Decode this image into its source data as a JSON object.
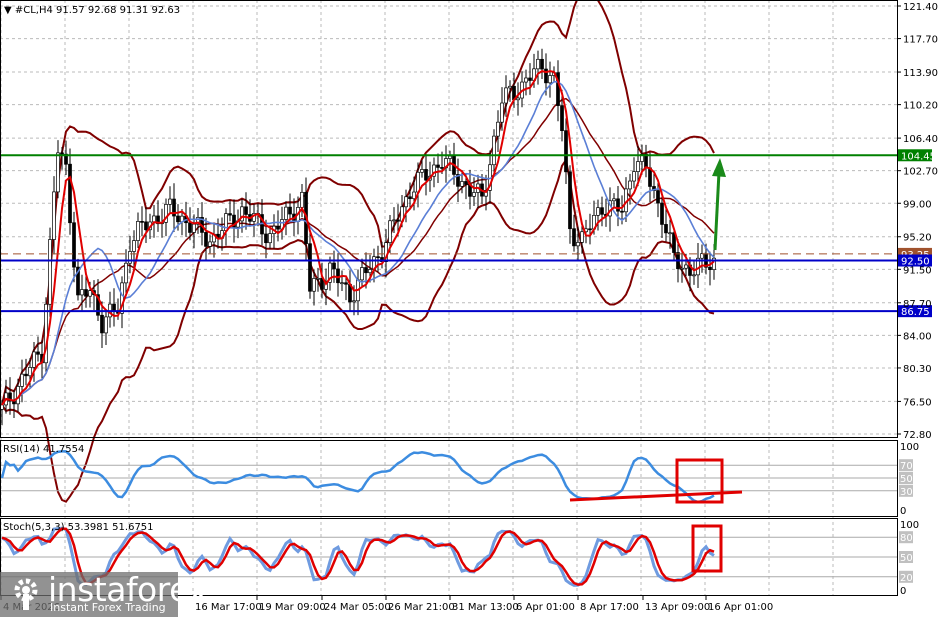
{
  "header": {
    "symbol_line": "#CL,H4  91.57 92.68 91.31 92.63"
  },
  "price_axis": {
    "labels": [
      "121.40",
      "117.70",
      "113.90",
      "110.20",
      "106.40",
      "102.70",
      "99.00",
      "95.20",
      "91.50",
      "87.70",
      "84.00",
      "80.30",
      "76.50",
      "72.80"
    ]
  },
  "levels": {
    "resistance": {
      "label": "104.45",
      "value": 104.45,
      "color": "#008000"
    },
    "current": {
      "label": "93.25",
      "value": 93.25,
      "color": "#a0522d"
    },
    "support1": {
      "label": "92.50",
      "value": 92.5,
      "color": "#0000c8"
    },
    "support2": {
      "label": "86.75",
      "value": 86.75,
      "color": "#0000c8"
    }
  },
  "rsi": {
    "title": "RSI(14) 41.7554",
    "labels": [
      "100",
      "70",
      "50",
      "30",
      "0"
    ]
  },
  "stoch": {
    "title": "Stoch(5,3,3) 53.3981 51.6751",
    "labels": [
      "100",
      "80",
      "50",
      "20",
      "0"
    ]
  },
  "time_axis": {
    "labels": [
      "4 Mar 2026",
      "16 Mar 17:00",
      "19 Mar 09:00",
      "24 Mar 05:00",
      "26 Mar 21:00",
      "31 Mar 13:00",
      "6 Apr 01:00",
      "8 Apr 17:00",
      "13 Apr 09:00",
      "16 Apr 01:00"
    ]
  },
  "watermark": {
    "brand": "instaforex",
    "tagline": "Instant Forex Trading"
  },
  "chart_data": {
    "type": "candlestick",
    "title": "#CL,H4",
    "ylim": [
      72.8,
      121.4
    ],
    "close_keypoints": [
      [
        0,
        75.5
      ],
      [
        5,
        79
      ],
      [
        10,
        82.3
      ],
      [
        13,
        100
      ],
      [
        14,
        105
      ],
      [
        16,
        102.8
      ],
      [
        19,
        88
      ],
      [
        22,
        89
      ],
      [
        25,
        85.7
      ],
      [
        29,
        86.9
      ],
      [
        32,
        94.8
      ],
      [
        37,
        97
      ],
      [
        42,
        98.2
      ],
      [
        46,
        97
      ],
      [
        52,
        94.8
      ],
      [
        60,
        98.2
      ],
      [
        67,
        95.4
      ],
      [
        75,
        99.4
      ],
      [
        77,
        89.2
      ],
      [
        82,
        91.4
      ],
      [
        87,
        88.6
      ],
      [
        95,
        93.7
      ],
      [
        102,
        100.5
      ],
      [
        110,
        103.9
      ],
      [
        117,
        100.5
      ],
      [
        120,
        99.4
      ],
      [
        125,
        110.7
      ],
      [
        130,
        112.4
      ],
      [
        135,
        114.7
      ],
      [
        138,
        113
      ],
      [
        140,
        107.3
      ],
      [
        142,
        96
      ],
      [
        145,
        94.8
      ],
      [
        150,
        98.8
      ],
      [
        155,
        98.2
      ],
      [
        158,
        103.9
      ],
      [
        161,
        102.8
      ],
      [
        165,
        97.7
      ],
      [
        168,
        92.6
      ],
      [
        172,
        91.4
      ],
      [
        178,
        92.6
      ]
    ],
    "indicators": [
      "SMA fast (red)",
      "SMA slow (blue)",
      "Bollinger Bands (dark red)",
      "RSI(14)",
      "Stochastic(5,3,3)"
    ],
    "annotations": [
      "green up arrow toward 104.45",
      "red RSI rising trendline",
      "red boxes on RSI and Stoch"
    ]
  }
}
